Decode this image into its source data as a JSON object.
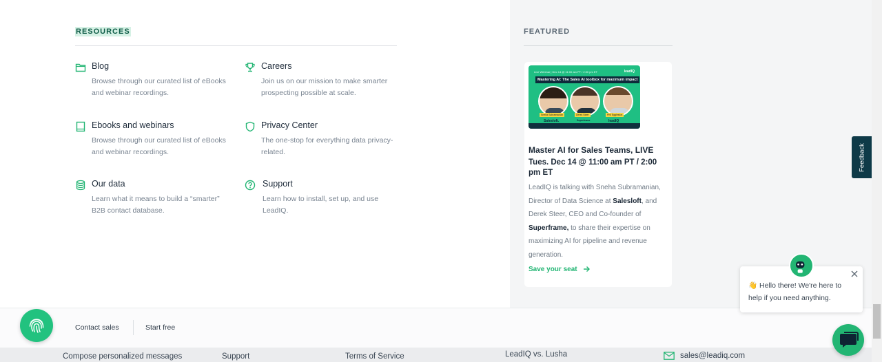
{
  "resources": {
    "heading": "RESOURCES",
    "items": [
      {
        "icon": "folder-icon",
        "title": "Blog",
        "desc": "Browse through our curated list of eBooks and webinar recordings."
      },
      {
        "icon": "trophy-icon",
        "title": "Careers",
        "desc": "Join us on our mission to make smarter prospecting possible at scale."
      },
      {
        "icon": "book-icon",
        "title": "Ebooks and webinars",
        "desc": "Browse through our curated list of eBooks and webinar recordings."
      },
      {
        "icon": "shield-icon",
        "title": "Privacy Center",
        "desc": "The one-stop for everything data privacy-related."
      },
      {
        "icon": "database-icon",
        "title": "Our data",
        "desc": "Learn what it means to build a “smarter” B2B contact database."
      },
      {
        "icon": "help-circle-icon",
        "title": "Support",
        "desc": "Learn how to install, set up, and use LeadIQ."
      }
    ]
  },
  "featured": {
    "heading": "FEATURED",
    "thumb": {
      "topline": "Live Webinar | Dec 14 @ 11:00 am PT / 2:00 pm ET",
      "logo": "leadIQ",
      "title": "Mastering AI: The Sales AI toolbox for maximum impact",
      "speakers": [
        "Sneha Subramanian",
        "Derek Steer",
        "Phil Eggleston"
      ],
      "brands": [
        "Salesloft.",
        "Superframe",
        "leadIQ"
      ]
    },
    "title": "Master AI for Sales Teams, LIVE",
    "date": "Tues. Dec 14 @ 11:00 am PT / 2:00 pm ET",
    "body_1": "LeadIQ is talking with Sneha Subramanian, Director of Data Science at ",
    "body_bold_1": "Salesloft",
    "body_2": ", and Derek Steer, CEO and Co-founder of ",
    "body_bold_2": "Superframe,",
    "body_3": " to share their expertise on maximizing AI for pipeline and revenue generation.",
    "link": "Save your seat"
  },
  "feedback": {
    "label": "Feedback"
  },
  "chat": {
    "message": "👋 Hello there! We're here to help if you need anything."
  },
  "cta": {
    "contact": "Contact sales",
    "start": "Start free"
  },
  "footer": {
    "col1": "Compose personalized messages",
    "col2": "Support",
    "col3": "Terms of Service",
    "col4": "LeadIQ vs. Lusha",
    "email": "sales@leadiq.com"
  },
  "colors": {
    "brand_green": "#22b573",
    "dark_teal": "#0e3a48"
  }
}
